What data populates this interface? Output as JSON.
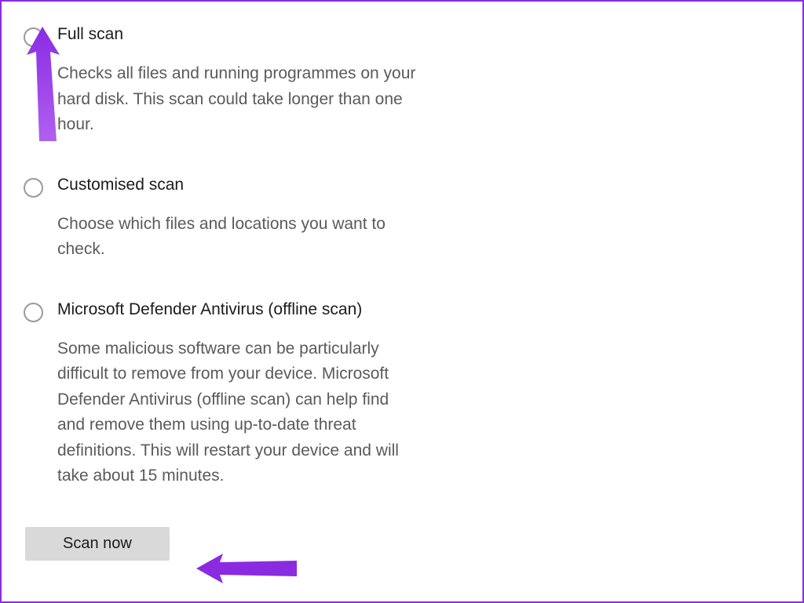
{
  "options": [
    {
      "title": "Full scan",
      "desc": "Checks all files and running programmes on your hard disk. This scan could take longer than one hour."
    },
    {
      "title": "Customised scan",
      "desc": "Choose which files and locations you want to check."
    },
    {
      "title": "Microsoft Defender Antivirus (offline scan)",
      "desc": "Some malicious software can be particularly difficult to remove from your device. Microsoft Defender Antivirus (offline scan) can help find and remove them using up-to-date threat definitions. This will restart your device and will take about 15 minutes."
    }
  ],
  "scan_button": "Scan now"
}
